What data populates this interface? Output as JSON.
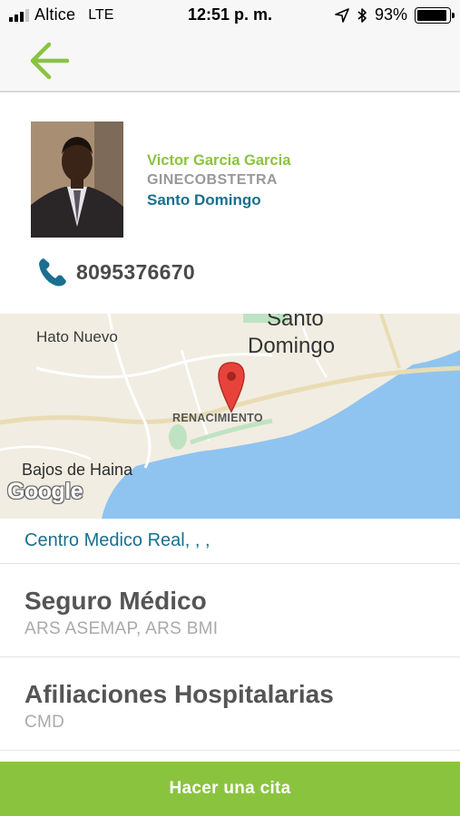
{
  "status_bar": {
    "carrier": "Altice",
    "network": "LTE",
    "time": "12:51 p. m.",
    "battery_percent": "93%",
    "battery_level": 0.93
  },
  "nav": {
    "back_icon": "back-arrow-icon",
    "accent_color": "#8ac43f"
  },
  "doctor": {
    "name": "Victor Garcia Garcia",
    "specialty": "GINECOBSTETRA",
    "city": "Santo Domingo",
    "phone": "8095376670",
    "phone_icon": "phone-icon",
    "name_color": "#8ac43f",
    "city_color": "#1a6f8f"
  },
  "map": {
    "labels": {
      "hato_nuevo": "Hato Nuevo",
      "santo": "Santo",
      "domingo": "Domingo",
      "renacimiento": "RENACIMIENTO",
      "bajos_de_haina": "Bajos de Haina"
    },
    "provider": "Google",
    "pin_icon": "map-pin-icon"
  },
  "clinic": {
    "text": "Centro Medico Real, , ,"
  },
  "insurance": {
    "title": "Seguro Médico",
    "value": "ARS ASEMAP, ARS BMI"
  },
  "affiliations": {
    "title": "Afiliaciones Hospitalarias",
    "value": "CMD"
  },
  "cta": {
    "label": "Hacer una cita"
  }
}
